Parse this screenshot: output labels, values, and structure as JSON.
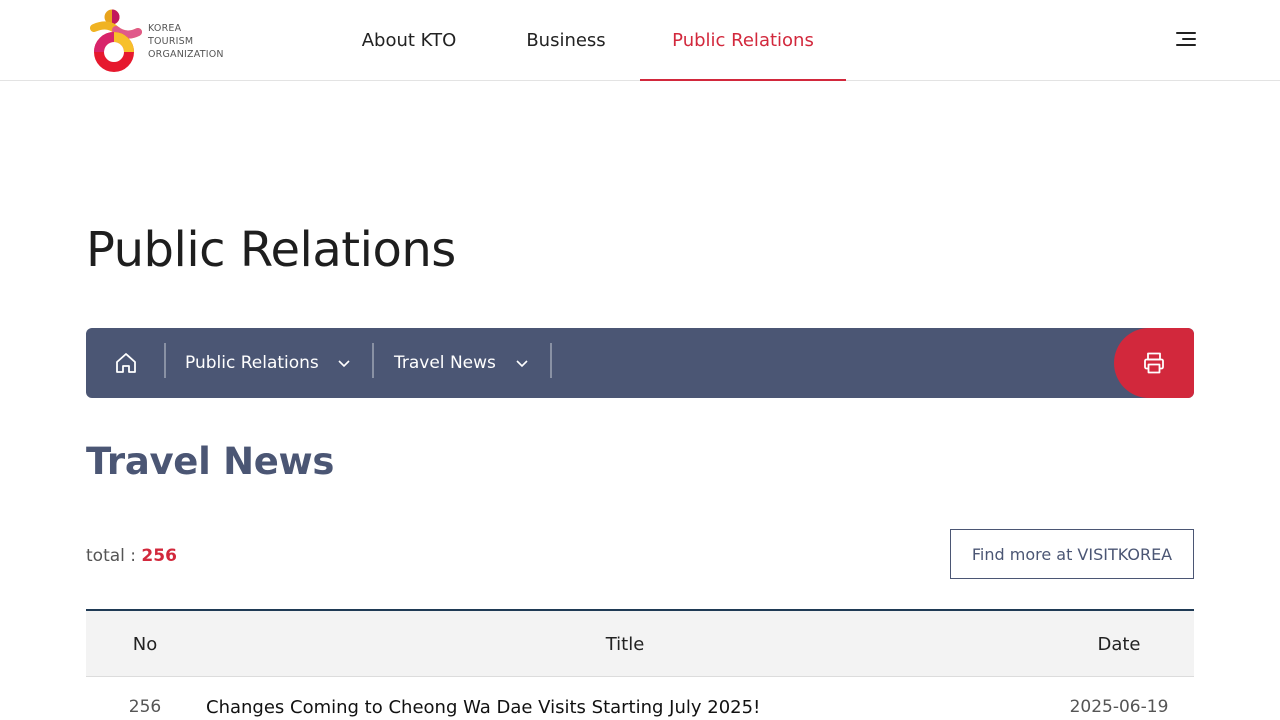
{
  "header": {
    "logo_lines": [
      "KOREA",
      "TOURISM",
      "ORGANIZATION"
    ],
    "nav": [
      {
        "label": "About KTO"
      },
      {
        "label": "Business"
      },
      {
        "label": "Public Relations",
        "active": true
      }
    ],
    "menu_icon": "hamburger-menu-icon"
  },
  "page": {
    "title": "Public Relations"
  },
  "breadcrumb": {
    "home_icon": "home-icon",
    "items": [
      {
        "label": "Public Relations"
      },
      {
        "label": "Travel News"
      }
    ],
    "print_icon": "printer-icon"
  },
  "section": {
    "title": "Travel News",
    "total_label": "total : ",
    "total_count": "256",
    "find_more": "Find more at VISITKOREA"
  },
  "table": {
    "headers": {
      "no": "No",
      "title": "Title",
      "date": "Date"
    },
    "rows": [
      {
        "no": "256",
        "title": "Changes Coming to Cheong Wa Dae Visits Starting July 2025!",
        "date": "2025-06-19"
      }
    ]
  },
  "colors": {
    "accent": "#d2283c",
    "navy": "#4b5674",
    "table_border": "#1f3a55"
  }
}
